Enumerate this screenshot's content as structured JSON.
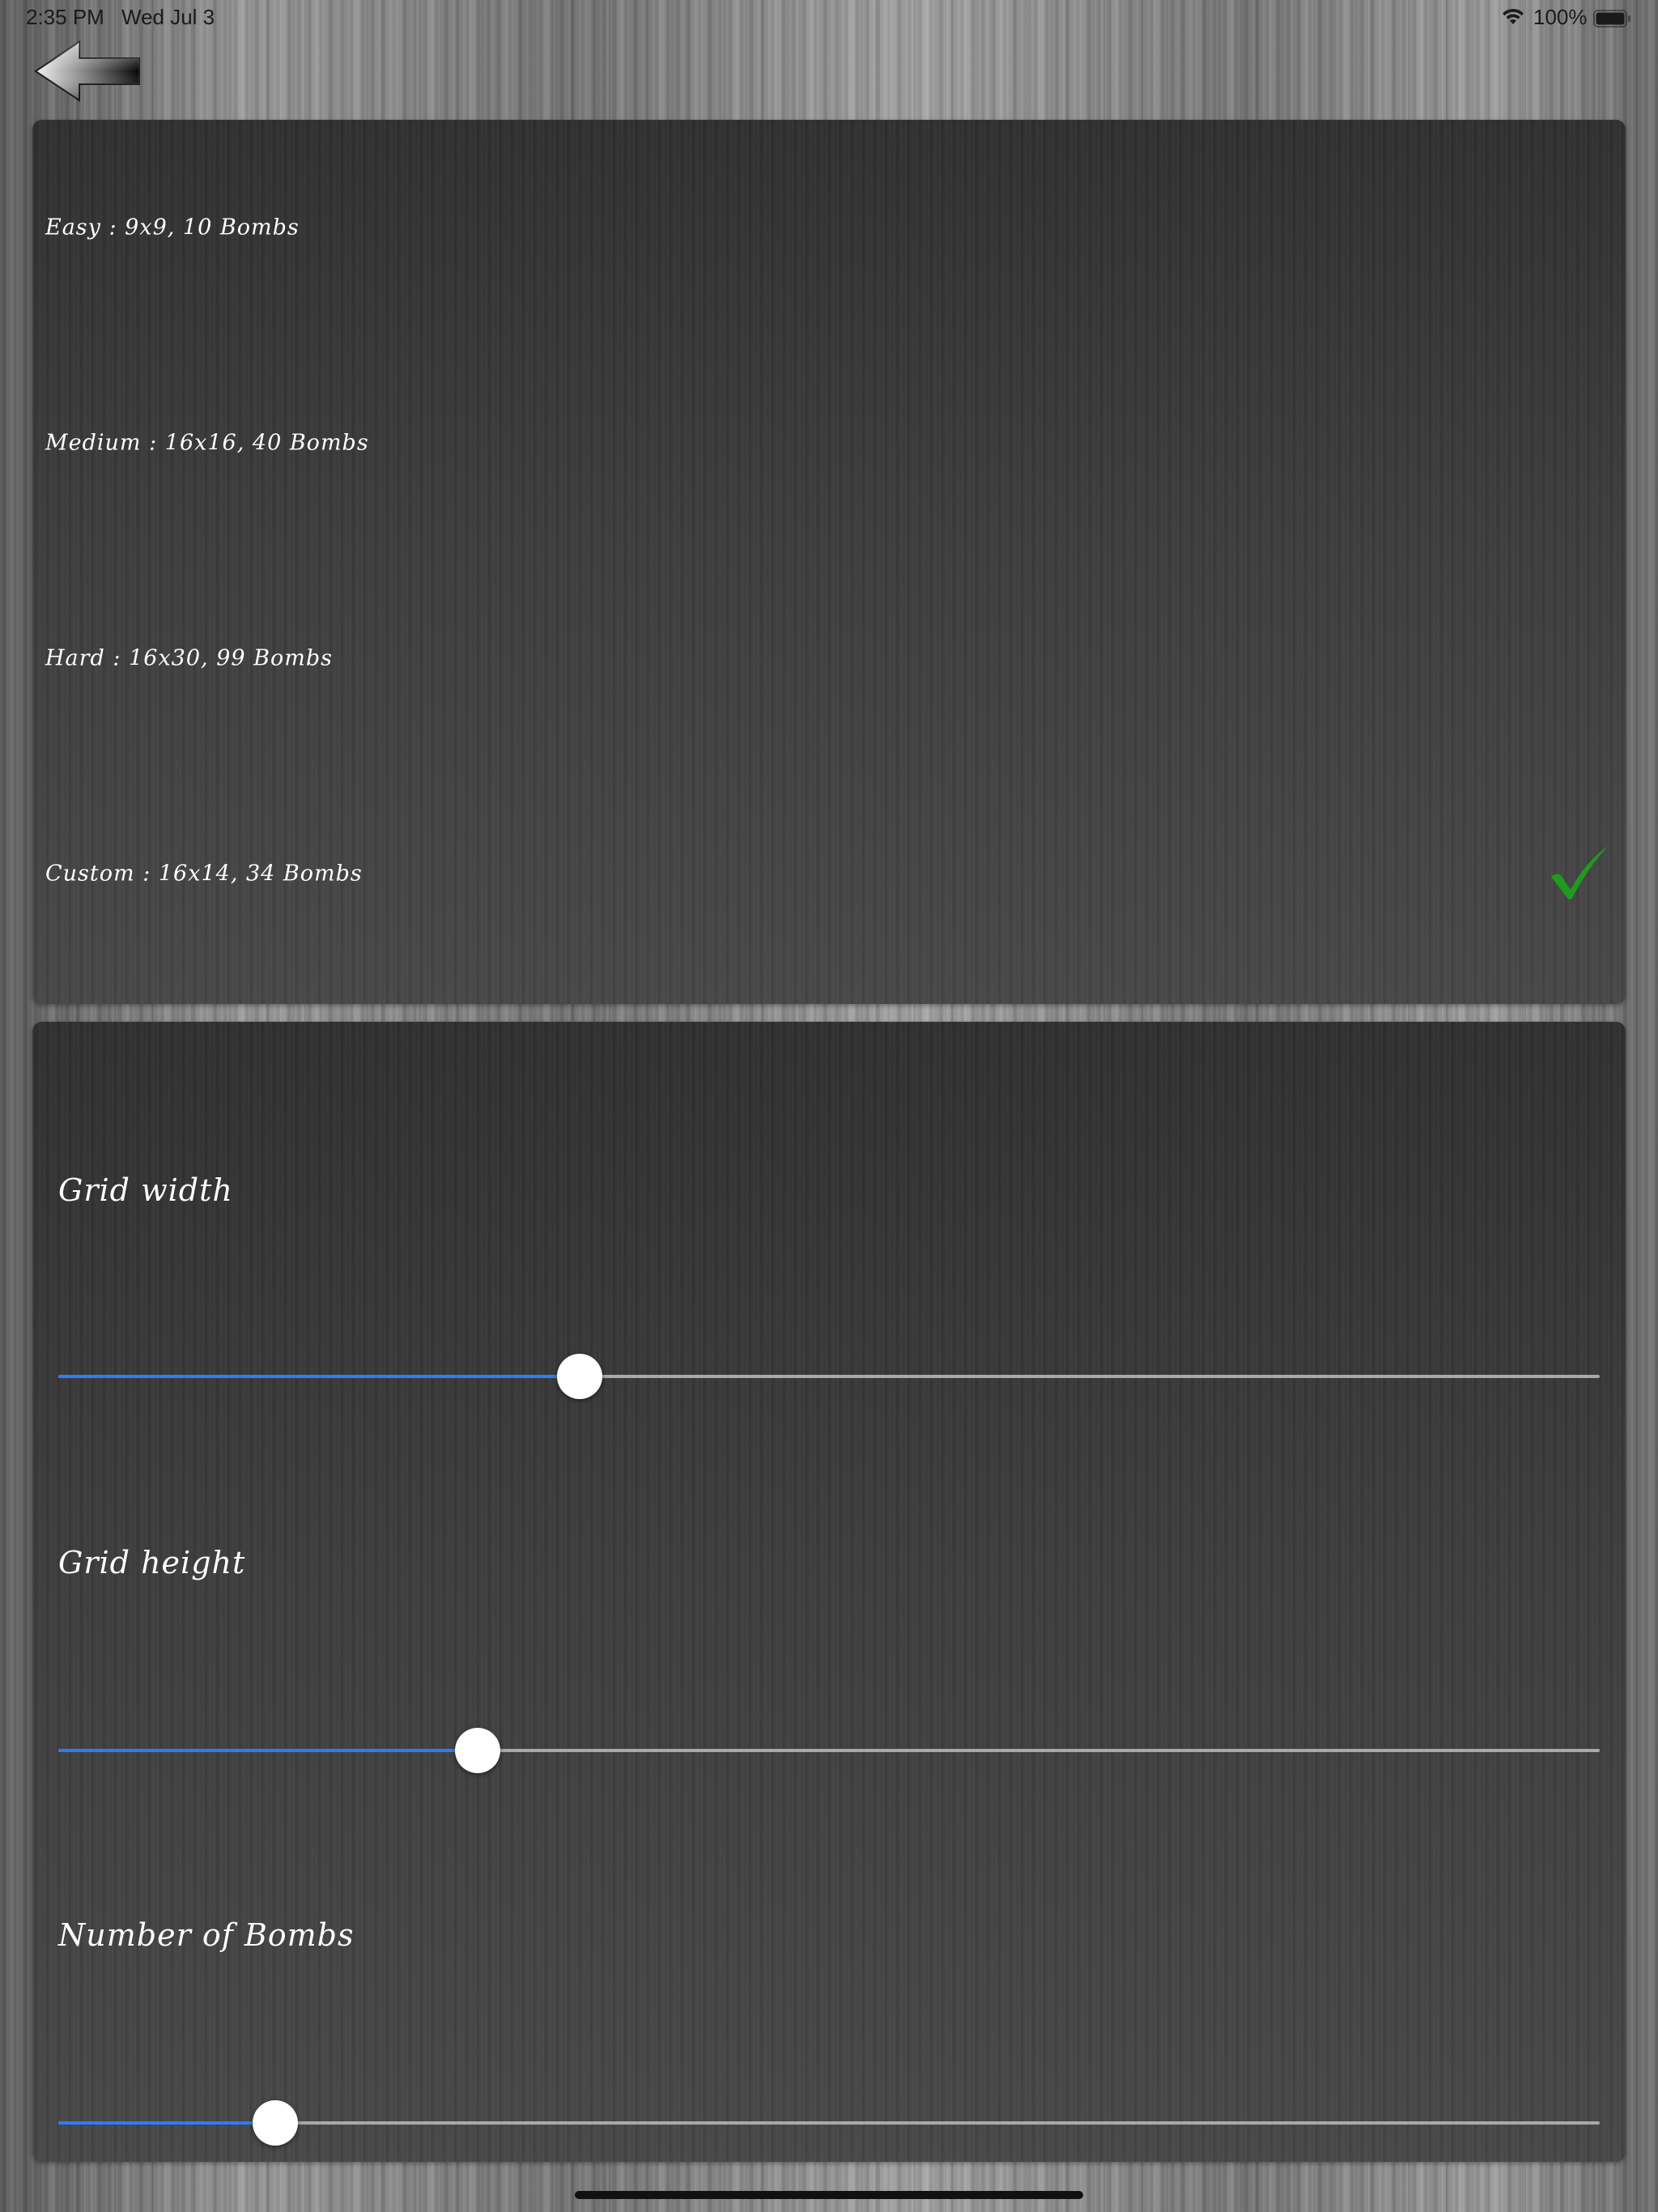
{
  "status_bar": {
    "time": "2:35 PM",
    "date": "Wed Jul 3",
    "battery_percent": "100%",
    "battery_level": 1.0,
    "icons": [
      "wifi-icon",
      "battery-icon"
    ]
  },
  "back_button": {
    "icon": "back-arrow-icon"
  },
  "difficulty": {
    "options": [
      {
        "label": "Easy : 9x9, 10 Bombs",
        "selected": false
      },
      {
        "label": "Medium : 16x16, 40 Bombs",
        "selected": false
      },
      {
        "label": "Hard : 16x30, 99 Bombs",
        "selected": false
      },
      {
        "label": "Custom : 16x14, 34 Bombs",
        "selected": true
      }
    ],
    "selected_icon": "checkmark-icon",
    "selected_color": "#1e9b1e"
  },
  "custom": {
    "grid_width": {
      "label": "Grid width",
      "fraction": 0.338
    },
    "grid_height": {
      "label": "Grid height",
      "fraction": 0.272
    },
    "bombs": {
      "label": "Number of Bombs",
      "fraction": 0.141
    }
  },
  "colors": {
    "slider_active": "#2f7cf6",
    "slider_inactive": "#a9a9a9"
  }
}
